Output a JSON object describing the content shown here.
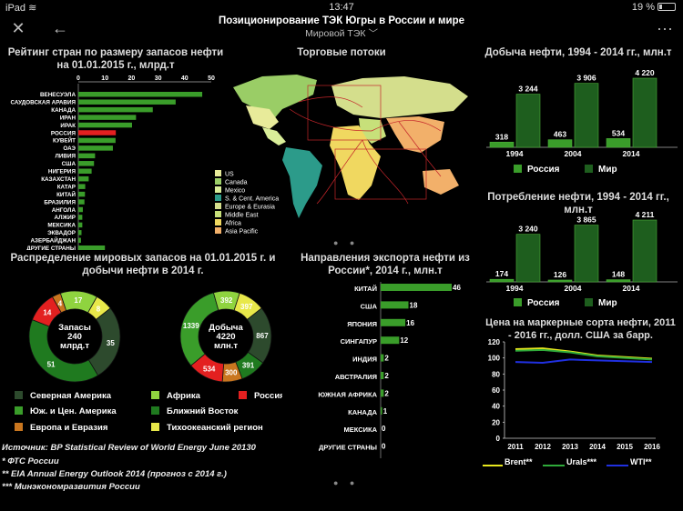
{
  "status_bar": {
    "device": "iPad",
    "time": "13:47",
    "battery": "19 %"
  },
  "nav": {
    "title": "Позиционирование ТЭК Югры в России и мире",
    "subtitle": "Мировой ТЭК"
  },
  "colors": {
    "green": "#3a9d2a",
    "dark_green": "#1e5e1e",
    "red": "#e32020",
    "light_green": "#8fd33f",
    "yellow": "#e8e84a",
    "orange": "#c9761f",
    "dark_olive": "#2d4a2d"
  },
  "panels": {
    "reserves_rank": "Рейтинг стран по размеру запасов нефти на 01.01.2015 г., млрд.т",
    "trade_flows": "Торговые потоки",
    "production": "Добыча нефти, 1994 - 2014 гг., млн.т",
    "consumption": "Потребление нефти, 1994 - 2014 гг., млн.т",
    "distribution": "Распределение мировых запасов на 01.01.2015 г. и добычи нефти в 2014 г.",
    "exports": "Направления экспорта нефти из России*, 2014 г., млн.т",
    "prices": "Цена на маркерные сорта нефти, 2011 - 2016 гг., долл. США за барр."
  },
  "map_legend": [
    "US",
    "Canada",
    "Mexico",
    "S. & Cent. America",
    "Europe & Eurasia",
    "Middle East",
    "Africa",
    "Asia Pacific"
  ],
  "donuts": {
    "reserves": {
      "center": [
        "Запасы",
        "240",
        "млрд.т"
      ],
      "values": [
        35,
        51,
        14,
        4,
        17,
        8
      ]
    },
    "production": {
      "center": [
        "Добыча",
        "4220",
        "млн.т"
      ],
      "values": [
        867,
        391,
        300,
        534,
        1339,
        392,
        397
      ]
    }
  },
  "donut_legend": [
    {
      "label": "Северная Америка",
      "color": "#2d4a2d"
    },
    {
      "label": "Африка",
      "color": "#8fd33f"
    },
    {
      "label": "Россия",
      "color": "#e32020"
    },
    {
      "label": "Юж. и Цен. Америка",
      "color": "#3a9d2a"
    },
    {
      "label": "Ближний Восток",
      "color": "#1f7a1f"
    },
    {
      "label": "Европа и Евразия",
      "color": "#c9761f"
    },
    {
      "label": "Тихоокеанский регион",
      "color": "#e8e84a"
    }
  ],
  "sources": [
    "Источник:  BP Statistical Review of World Energy June 20130",
    "* ФТС России",
    "** EIA Annual Energy Outlook 2014 (прогноз с 2014 г.)",
    "*** Минэкономразвития  России"
  ],
  "chart_data": [
    {
      "type": "bar",
      "title": "Рейтинг стран по размеру запасов нефти на 01.01.2015 г., млрд.т",
      "orientation": "horizontal",
      "categories": [
        "ВЕНЕСУЭЛА",
        "САУДОВСКАЯ АРАВИЯ",
        "КАНАДА",
        "ИРАН",
        "ИРАК",
        "РОССИЯ",
        "КУВЕЙТ",
        "ОАЭ",
        "ЛИВИЯ",
        "США",
        "НИГЕРИЯ",
        "КАЗАХСТАН",
        "КАТАР",
        "КИТАЙ",
        "БРАЗИЛИЯ",
        "АНГОЛА",
        "АЛЖИР",
        "МЕКСИКА",
        "ЭКВАДОР",
        "АЗЕРБАЙДЖАН",
        "ДРУГИЕ СТРАНЫ"
      ],
      "values": [
        46.6,
        36.6,
        28.0,
        21.7,
        20.2,
        14.1,
        14.0,
        13.0,
        6.3,
        5.9,
        5.0,
        3.9,
        2.6,
        2.5,
        2.3,
        1.7,
        1.5,
        1.5,
        1.2,
        1.0,
        10.0
      ],
      "highlight": "РОССИЯ",
      "xticks": [
        0,
        10,
        20,
        30,
        40,
        50
      ],
      "xlim": [
        0,
        50
      ]
    },
    {
      "type": "bar",
      "title": "Добыча нефти, 1994 - 2014 гг., млн.т",
      "categories": [
        "1994",
        "2004",
        "2014"
      ],
      "series": [
        {
          "name": "Россия",
          "values": [
            318,
            463,
            534
          ]
        },
        {
          "name": "Мир",
          "values": [
            3244,
            3906,
            4220
          ]
        }
      ],
      "labels": [
        [
          "318",
          "463",
          "534"
        ],
        [
          "3 244",
          "3 906",
          "4 220"
        ]
      ]
    },
    {
      "type": "bar",
      "title": "Потребление нефти, 1994 - 2014 гг., млн.т",
      "categories": [
        "1994",
        "2004",
        "2014"
      ],
      "series": [
        {
          "name": "Россия",
          "values": [
            174,
            126,
            148
          ]
        },
        {
          "name": "Мир",
          "values": [
            3240,
            3865,
            4211
          ]
        }
      ],
      "labels": [
        [
          "174",
          "126",
          "148"
        ],
        [
          "3 240",
          "3 865",
          "4 211"
        ]
      ]
    },
    {
      "type": "bar",
      "title": "Направления экспорта нефти из России*, 2014 г., млн.т",
      "orientation": "horizontal",
      "categories": [
        "КИТАЙ",
        "США",
        "ЯПОНИЯ",
        "СИНГАПУР",
        "ИНДИЯ",
        "АВСТРАЛИЯ",
        "ЮЖНАЯ АФРИКА",
        "КАНАДА",
        "МЕКСИКА",
        "ДРУГИЕ СТРАНЫ"
      ],
      "values": [
        46,
        18,
        16,
        12,
        2,
        2,
        2,
        1,
        0,
        0
      ]
    },
    {
      "type": "line",
      "title": "Цена на маркерные сорта нефти, 2011 - 2016 гг., долл. США за барр.",
      "x": [
        2011,
        2012,
        2013,
        2014,
        2015,
        2016
      ],
      "series": [
        {
          "name": "Brent**",
          "color": "#e8e81e",
          "values": [
            111,
            112,
            108,
            103,
            101,
            99
          ]
        },
        {
          "name": "Urals***",
          "color": "#2faa3a",
          "values": [
            109,
            110,
            107,
            102,
            100,
            98
          ]
        },
        {
          "name": "WTI**",
          "color": "#2030e0",
          "values": [
            95,
            94,
            98,
            97,
            96,
            95
          ]
        }
      ],
      "yticks": [
        0,
        20,
        40,
        60,
        80,
        100,
        120
      ],
      "ylim": [
        0,
        120
      ]
    }
  ]
}
